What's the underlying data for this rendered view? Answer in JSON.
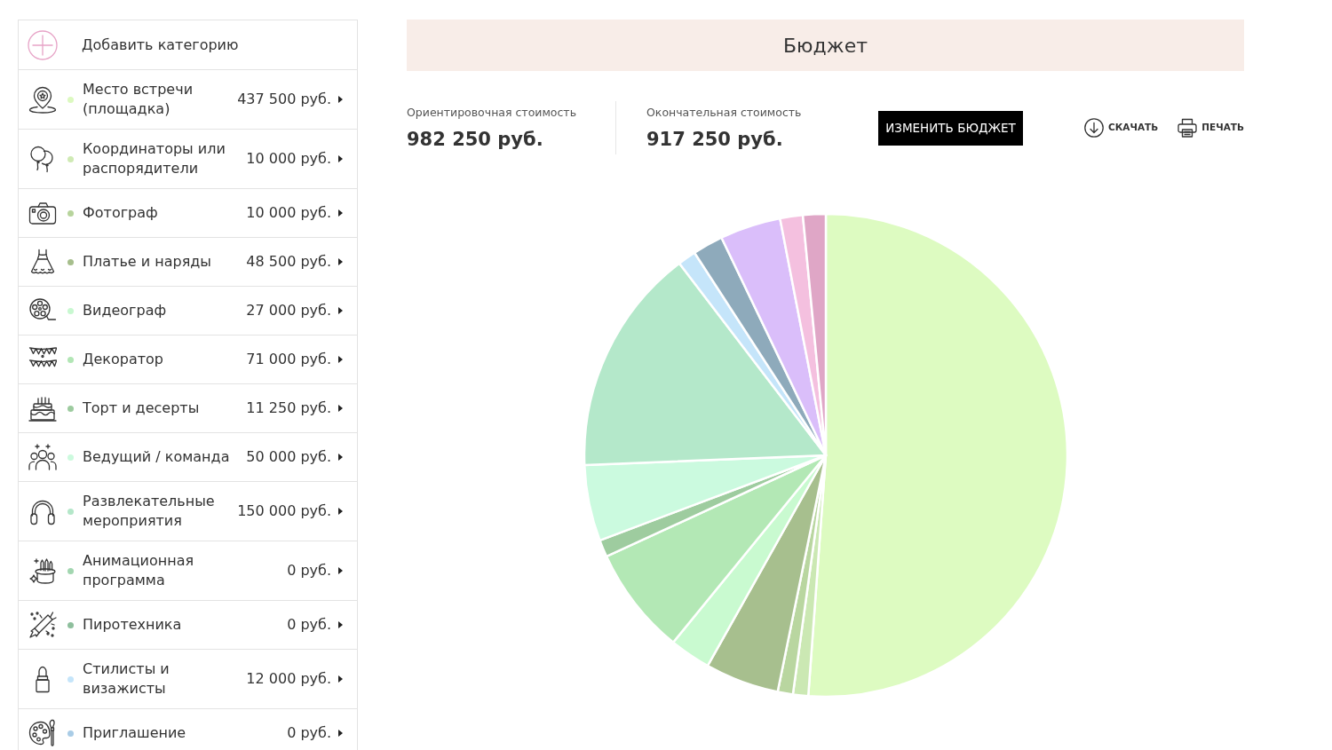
{
  "sidebar": {
    "add_button": {
      "label": "Добавить категорию"
    },
    "categories": [
      {
        "name": "Место встречи (площадка)",
        "amount": "437 500 руб.",
        "color": "#dcf9c0"
      },
      {
        "name": "Координаторы или распорядители",
        "amount": "10 000 руб.",
        "color": "#cfeab4"
      },
      {
        "name": "Фотограф",
        "amount": "10 000 руб.",
        "color": "#b7d49c"
      },
      {
        "name": "Платье и наряды",
        "amount": "48 500 руб.",
        "color": "#a6be8c"
      },
      {
        "name": "Видеограф",
        "amount": "27 000 руб.",
        "color": "#c8f8d0"
      },
      {
        "name": "Декоратор",
        "amount": "71 000 руб.",
        "color": "#b2e6b5"
      },
      {
        "name": "Торт и десерты",
        "amount": "11 250 руб.",
        "color": "#9dcb9f"
      },
      {
        "name": "Ведущий / команда",
        "amount": "50 000 руб.",
        "color": "#ccfade"
      },
      {
        "name": "Развлекательные мероприятия",
        "amount": "150 000 руб.",
        "color": "#b4e7c9"
      },
      {
        "name": "Анимационная программа",
        "amount": "0 руб.",
        "color": "#a2d6b0"
      },
      {
        "name": "Пиротехника",
        "amount": "0 руб.",
        "color": "#8ebf9d"
      },
      {
        "name": "Стилисты и визажисты",
        "amount": "12 000 руб.",
        "color": "#c5e5fa"
      },
      {
        "name": "Приглашение",
        "amount": "0 руб.",
        "color": "#a9cce6"
      }
    ]
  },
  "header": {
    "title": "Бюджет"
  },
  "summary": [
    {
      "label": "Ориентировочная стоимость",
      "value": "982 250 руб."
    },
    {
      "label": "Окончательная стоимость",
      "value": "917 250 руб."
    }
  ],
  "actions": {
    "edit_button": "ИЗМЕНИТЬ БЮДЖЕТ",
    "download": "СКАЧАТЬ",
    "print": "ПЕЧАТЬ"
  },
  "chart": {
    "chart_data": {
      "type": "pie",
      "values": [
        51.16,
        1.02,
        1.02,
        4.94,
        2.75,
        7.23,
        1.15,
        5.09,
        15.27,
        1.22,
        2.04,
        4.07,
        1.52,
        1.52
      ],
      "colors": [
        "#ddfbc1",
        "#cbe8b3",
        "#b9d6a0",
        "#a7bf8e",
        "#c9fad0",
        "#b3e8b5",
        "#9ecc9f",
        "#cbfadf",
        "#b4e8ca",
        "#c5e5fa",
        "#8eaabb",
        "#dabefa",
        "#f4c0df",
        "#dfa6c6"
      ]
    }
  }
}
